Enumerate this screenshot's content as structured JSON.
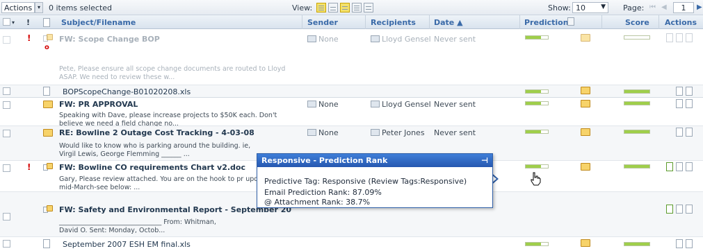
{
  "toolbar": {
    "actions_label": "Actions",
    "selected_text": "0 items selected",
    "view_label": "View:",
    "show_label": "Show:",
    "show_value": "10",
    "page_label": "Page:",
    "page_value": "1"
  },
  "columns": {
    "subject": "Subject/Filename",
    "sender": "Sender",
    "recipients": "Recipients",
    "date": "Date ▲",
    "prediction": "Prediction",
    "score": "Score",
    "actions": "Actions"
  },
  "rows": [
    {
      "subject": "FW: Scope Change BOP",
      "snippet": "Pete, Please ensure all scope change documents are routed to Lloyd ASAP. We need to review these w...",
      "sender": "None",
      "recipient": "Lloyd Gensel",
      "date": "Never sent",
      "attachment": "BOPScopeChange-B01020208.xls"
    },
    {
      "subject": "FW: PR APPROVAL",
      "snippet": "Speaking with Dave, please increase projects to $50K each. Don't believe we need a field change no...",
      "sender": "None",
      "recipient": "Lloyd Gensel",
      "date": "Never sent"
    },
    {
      "subject": "RE: Bowline 2 Outage Cost Tracking - 4-03-08",
      "snippet": "Would like to know who is parking around the building. ie, Virgil Lewis, George Flemming ______ ...",
      "sender": "None",
      "recipient": "Peter Jones",
      "date": "Never sent"
    },
    {
      "subject": "FW: Bowline CO requirements Chart v2.doc",
      "snippet": "Gary, Please review attached. You are on the hook to pr update by mid-March-see below: ..."
    },
    {
      "subject": "FW: Safety and Environmental Report - September 20",
      "snippet_a": "_______________________________ From: Whitman,",
      "snippet_b": "David O. Sent: Monday, Octob...",
      "attachment": "September 2007 ESH EM final.xls"
    }
  ],
  "popup": {
    "title": "Responsive - Prediction Rank",
    "line1": "Predictive Tag: Responsive (Review Tags:Responsive)",
    "line2": "Email Prediction Rank: 87.09%",
    "line3": "Attachment Rank: 38.7%"
  },
  "icons": [
    "dropdown-arrow-icon",
    "view-mode-icon",
    "flag-icon",
    "document-icon",
    "envelope-icon",
    "thread-icon",
    "tag-icon",
    "prediction-icon",
    "pin-icon",
    "hand-cursor-icon",
    "view-doc-icon",
    "page-nav-icon"
  ],
  "colors": {
    "accent": "#2f5fa8",
    "header_text": "#3a6aa8",
    "bar_fill": "#9fcf4a",
    "importance": "#d40000"
  }
}
